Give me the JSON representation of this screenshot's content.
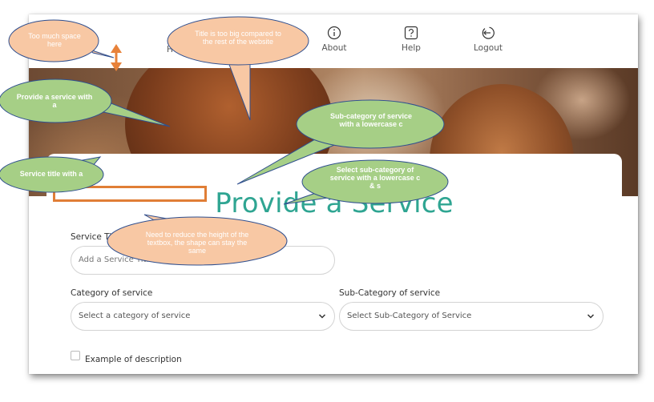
{
  "nav": {
    "partial_label": "H",
    "items": [
      {
        "label": "About",
        "icon": "info-icon"
      },
      {
        "label": "Help",
        "icon": "help-icon"
      },
      {
        "label": "Logout",
        "icon": "logout-icon"
      }
    ]
  },
  "form": {
    "title": "Provide a Service",
    "service_title_label": "Service Ti",
    "service_title_placeholder": "Add a Service Title",
    "category_label": "Category of service",
    "category_placeholder": "Select a category of service",
    "subcategory_label": "Sub-Category of service",
    "subcategory_placeholder": "Select Sub-Category of Service",
    "checkbox_label": "Example of description"
  },
  "annotations": {
    "too_much_space": "Too much space here",
    "title_too_big": "Title is too big compared to the rest of the website",
    "provide_service": "Provide a service with a",
    "subcategory_lowercase": "Sub-category of service with a lowercase c",
    "service_title": "Service title with a",
    "select_subcategory": "Select sub-category of service with a lowercase c & s",
    "reduce_height": "Need to reduce the height of the textbox, the shape can stay the same"
  },
  "colors": {
    "accent": "#2fa592",
    "callout_orange_fill": "#f8c8a4",
    "callout_green_fill": "#a6cf86",
    "callout_border": "#2f4f8f",
    "highlight_border": "#e07e36"
  }
}
